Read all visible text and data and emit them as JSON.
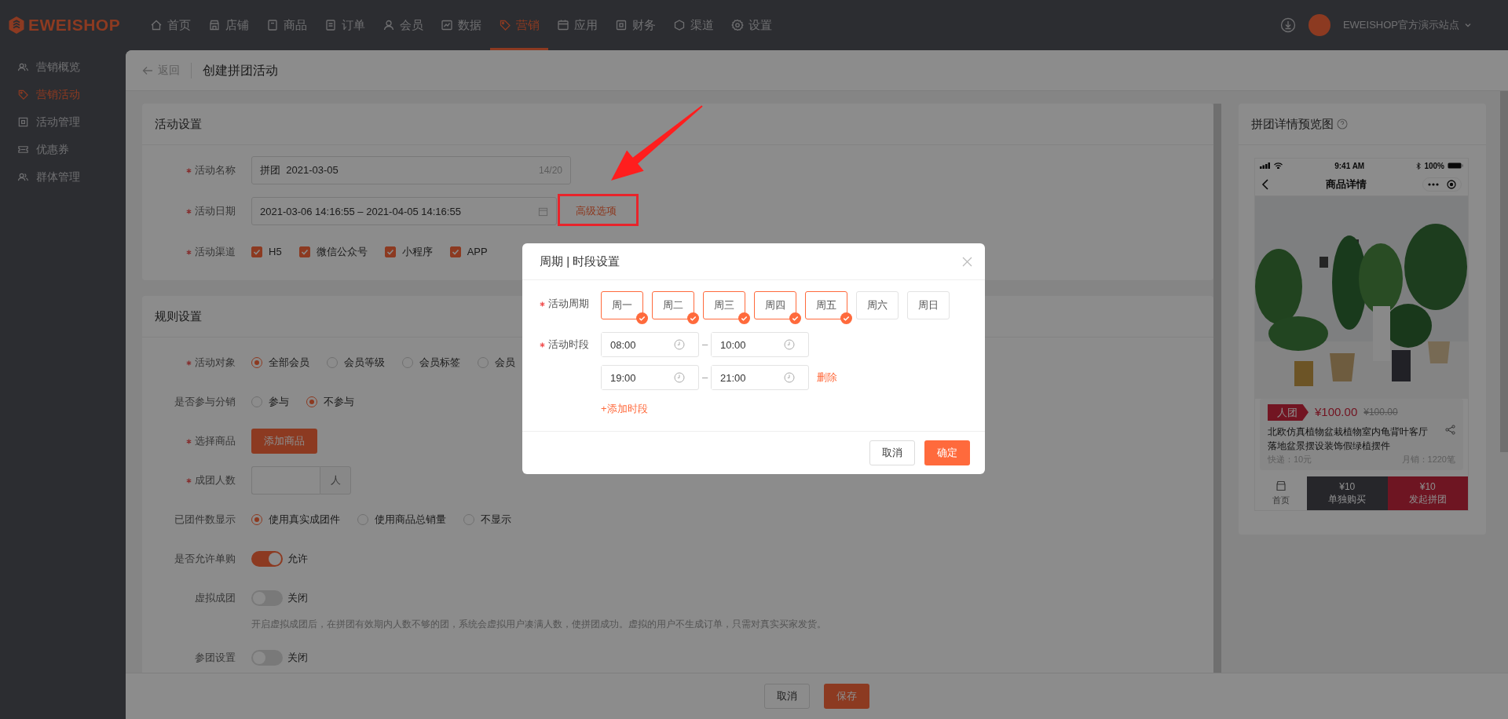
{
  "top_nav": {
    "logo": "EWEISHOP",
    "items": [
      {
        "label": "首页",
        "selected": false
      },
      {
        "label": "店铺",
        "selected": false
      },
      {
        "label": "商品",
        "selected": false
      },
      {
        "label": "订单",
        "selected": false
      },
      {
        "label": "会员",
        "selected": false
      },
      {
        "label": "数据",
        "selected": false
      },
      {
        "label": "营销",
        "selected": true
      },
      {
        "label": "应用",
        "selected": false
      },
      {
        "label": "财务",
        "selected": false
      },
      {
        "label": "渠道",
        "selected": false
      },
      {
        "label": "设置",
        "selected": false
      }
    ],
    "site": "EWEISHOP官方演示站点"
  },
  "sidebar": {
    "items": [
      {
        "label": "营销概览",
        "selected": false
      },
      {
        "label": "营销活动",
        "selected": true
      },
      {
        "label": "活动管理",
        "selected": false
      },
      {
        "label": "优惠券",
        "selected": false
      },
      {
        "label": "群体管理",
        "selected": false
      }
    ]
  },
  "breadcrumb": {
    "back": "返回",
    "title": "创建拼团活动"
  },
  "cards": [
    {
      "title": "活动设置",
      "rows": [
        {
          "kind": "text",
          "label": "活动名称",
          "required": true,
          "value": "拼团  2021-03-05",
          "counter": "14/20"
        },
        {
          "kind": "date",
          "label": "活动日期",
          "required": true,
          "value": "2021-03-06 14:16:55 – 2021-04-05 14:16:55",
          "link": "高级选项"
        },
        {
          "kind": "checkbox",
          "label": "活动渠道",
          "required": true,
          "options": [
            {
              "label": "H5",
              "checked": true
            },
            {
              "label": "微信公众号",
              "checked": true
            },
            {
              "label": "小程序",
              "checked": true
            },
            {
              "label": "APP",
              "checked": true
            }
          ]
        }
      ]
    },
    {
      "title": "规则设置",
      "rows": [
        {
          "kind": "radio",
          "label": "活动对象",
          "required": true,
          "options": [
            {
              "label": "全部会员",
              "selected": true
            },
            {
              "label": "会员等级",
              "selected": false
            },
            {
              "label": "会员标签",
              "selected": false
            },
            {
              "label": "会员",
              "selected": false
            }
          ]
        },
        {
          "kind": "radio",
          "label": "是否参与分销",
          "required": false,
          "options": [
            {
              "label": "参与",
              "selected": false
            },
            {
              "label": "不参与",
              "selected": true
            }
          ]
        },
        {
          "kind": "button",
          "label": "选择商品",
          "required": true,
          "button": "添加商品"
        },
        {
          "kind": "number",
          "label": "成团人数",
          "required": true,
          "unit": "人"
        },
        {
          "kind": "radio",
          "label": "已团件数显示",
          "required": false,
          "options": [
            {
              "label": "使用真实成团件",
              "selected": true
            },
            {
              "label": "使用商品总销量",
              "selected": false
            },
            {
              "label": "不显示",
              "selected": false
            }
          ]
        },
        {
          "kind": "toggle",
          "label": "是否允许单购",
          "required": false,
          "on": true,
          "text": "允许"
        },
        {
          "kind": "toggle",
          "label": "虚拟成团",
          "required": false,
          "on": false,
          "text": "关闭",
          "help": "开启虚拟成团后，在拼团有效期内人数不够的团，系统会虚拟用户凑满人数，使拼团成功。虚拟的用户不生成订单，只需对真实买家发货。"
        },
        {
          "kind": "toggle",
          "label": "参团设置",
          "required": false,
          "on": false,
          "text": "关闭"
        }
      ]
    }
  ],
  "footer": {
    "buttons": [
      {
        "label": "取消",
        "kind": "default"
      },
      {
        "label": "保存",
        "kind": "primary"
      }
    ]
  },
  "preview": {
    "title": "拼团详情预览图",
    "time": "9:41 AM",
    "battery": "100%",
    "page_title": "商品详情",
    "badge": "人团",
    "price": "¥100.00",
    "original_price": "¥100.00",
    "product_name": "北欧仿真植物盆栽植物室内龟背叶客厅落地盆景摆设装饰假绿植摆件",
    "shipping": "快递：10元",
    "sales": "月销：1220笔",
    "home": "首页",
    "actions": [
      {
        "price": "¥10",
        "label": "单独购买",
        "kind": "single"
      },
      {
        "price": "¥10",
        "label": "发起拼团",
        "kind": "group"
      }
    ]
  },
  "modal": {
    "title": "周期 | 时段设置",
    "period": {
      "label": "活动周期",
      "required": true,
      "days": [
        {
          "label": "周一",
          "selected": true
        },
        {
          "label": "周二",
          "selected": true
        },
        {
          "label": "周三",
          "selected": true
        },
        {
          "label": "周四",
          "selected": true
        },
        {
          "label": "周五",
          "selected": true
        },
        {
          "label": "周六",
          "selected": false
        },
        {
          "label": "周日",
          "selected": false
        }
      ]
    },
    "slots": {
      "label": "活动时段",
      "required": true,
      "ranges": [
        {
          "start": "08:00",
          "separator": "–",
          "end": "10:00"
        },
        {
          "start": "19:00",
          "separator": "–",
          "end": "21:00",
          "delete": "删除"
        }
      ],
      "add": "+添加时段"
    },
    "buttons": [
      {
        "label": "取消",
        "kind": "default"
      },
      {
        "label": "确定",
        "kind": "primary"
      }
    ]
  }
}
